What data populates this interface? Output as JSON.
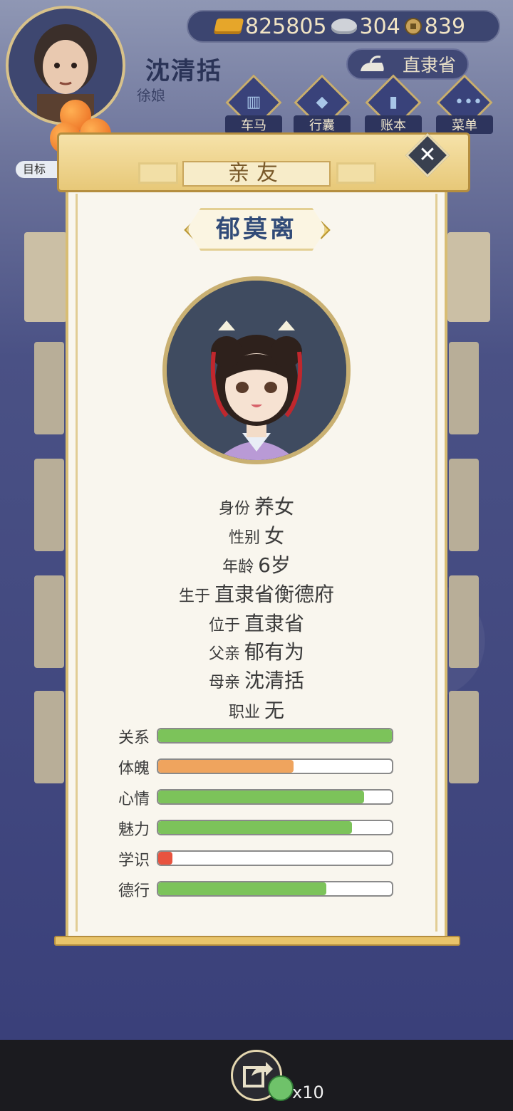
{
  "player": {
    "name": "沈清括",
    "role": "徐娘"
  },
  "currency": {
    "gold": "825805",
    "silver": "304",
    "coins": "839"
  },
  "province_button": "直隶省",
  "menu": [
    {
      "label": "车马",
      "icon": "carriage-icon"
    },
    {
      "label": "行囊",
      "icon": "bag-icon"
    },
    {
      "label": "账本",
      "icon": "ledger-icon"
    },
    {
      "label": "菜单",
      "icon": "more-icon"
    }
  ],
  "goal_label": "目标",
  "dialog": {
    "title": "亲友",
    "character_name": "郁莫离",
    "info": [
      {
        "key": "身份",
        "value": "养女"
      },
      {
        "key": "性别",
        "value": "女"
      },
      {
        "key": "年龄",
        "value": "6岁"
      },
      {
        "key": "生于",
        "value": "直隶省衡德府"
      },
      {
        "key": "位于",
        "value": "直隶省"
      },
      {
        "key": "父亲",
        "value": "郁有为"
      },
      {
        "key": "母亲",
        "value": "沈清括"
      },
      {
        "key": "职业",
        "value": "无"
      }
    ],
    "stats": [
      {
        "label": "关系",
        "value": 1.0,
        "color": "#7cc35a"
      },
      {
        "label": "体魄",
        "value": 0.58,
        "color": "#efa45e"
      },
      {
        "label": "心情",
        "value": 0.88,
        "color": "#7cc35a"
      },
      {
        "label": "魅力",
        "value": 0.83,
        "color": "#7cc35a"
      },
      {
        "label": "学识",
        "value": 0.06,
        "color": "#e8533f"
      },
      {
        "label": "德行",
        "value": 0.72,
        "color": "#7cc35a"
      }
    ]
  },
  "share": {
    "reward_count": "x10"
  }
}
